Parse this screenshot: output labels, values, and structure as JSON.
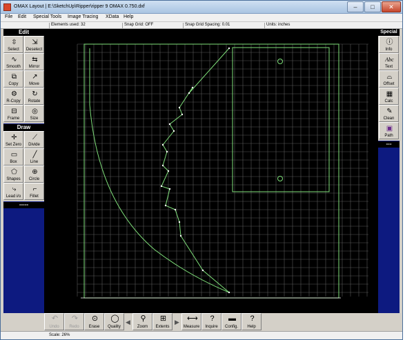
{
  "window": {
    "title": "OMAX Layout | E:\\SketchUp\\Ripper\\ripper 9 OMAX 0.750.dxf",
    "minimize": "–",
    "maximize": "□",
    "close": "✕"
  },
  "menu": [
    "File",
    "Edit",
    "Special Tools",
    "Image Tracing",
    "XData",
    "Help"
  ],
  "status": {
    "elements_used": "Elements used: 32",
    "snap_grid": "Snap Grid: OFF",
    "snap_spacing": "Snap Grid Spacing: 0.01",
    "units": "Units: inches"
  },
  "edit_panel": {
    "header": "Edit",
    "tools": [
      {
        "label": "Select",
        "icon": "select-icon",
        "glyph": "⇳"
      },
      {
        "label": "Deselect",
        "icon": "deselect-icon",
        "glyph": "⇲"
      },
      {
        "label": "Smooth",
        "icon": "smooth-icon",
        "glyph": "∿"
      },
      {
        "label": "Mirror",
        "icon": "mirror-icon",
        "glyph": "⇆"
      },
      {
        "label": "Copy",
        "icon": "copy-icon",
        "glyph": "⧉"
      },
      {
        "label": "Move",
        "icon": "move-icon",
        "glyph": "↗"
      },
      {
        "label": "R-Copy",
        "icon": "rotate-copy-icon",
        "glyph": "⚙"
      },
      {
        "label": "Rotate",
        "icon": "rotate-icon",
        "glyph": "↻"
      },
      {
        "label": "Frame",
        "icon": "frame-icon",
        "glyph": "⊟"
      },
      {
        "label": "Size",
        "icon": "size-icon",
        "glyph": "◎"
      }
    ]
  },
  "draw_panel": {
    "header": "Draw",
    "tools": [
      {
        "label": "Set Zero",
        "icon": "set-zero-icon",
        "glyph": "✛"
      },
      {
        "label": "Divide",
        "icon": "divide-icon",
        "glyph": "⟋"
      },
      {
        "label": "Box",
        "icon": "box-icon",
        "glyph": "▭"
      },
      {
        "label": "Line",
        "icon": "line-icon",
        "glyph": "╱"
      },
      {
        "label": "Shapes",
        "icon": "shapes-icon",
        "glyph": "⬠"
      },
      {
        "label": "Circle",
        "icon": "circle-icon",
        "glyph": "⊕"
      },
      {
        "label": "Lead i/o",
        "icon": "lead-io-icon",
        "glyph": "⤷"
      },
      {
        "label": "Fillet",
        "icon": "fillet-icon",
        "glyph": "⌐"
      }
    ],
    "dashes": "-----"
  },
  "special_panel": {
    "header": "Special",
    "tools": [
      {
        "label": "Info",
        "icon": "info-icon",
        "glyph": "ⓘ"
      },
      {
        "label": "Text",
        "icon": "text-icon",
        "glyph": "Abc"
      },
      {
        "label": "Offset",
        "icon": "offset-icon",
        "glyph": "⌓"
      },
      {
        "label": "Calc",
        "icon": "calculator-icon",
        "glyph": "▦"
      },
      {
        "label": "Clean",
        "icon": "clean-icon",
        "glyph": "✎"
      },
      {
        "label": "Path",
        "icon": "path-icon",
        "glyph": "▣"
      }
    ],
    "dashes": "---"
  },
  "bottom_toolbar": [
    {
      "label": "Undo",
      "icon": "undo-icon",
      "glyph": "↶",
      "disabled": true
    },
    {
      "label": "Redo",
      "icon": "redo-icon",
      "glyph": "↷",
      "disabled": true
    },
    {
      "label": "Erase",
      "icon": "erase-icon",
      "glyph": "⊙",
      "disabled": false
    },
    {
      "label": "Quality",
      "icon": "quality-icon",
      "glyph": "◯",
      "disabled": false
    },
    {
      "label": "Zoom",
      "icon": "zoom-icon",
      "glyph": "⚲",
      "disabled": false
    },
    {
      "label": "Extents",
      "icon": "extents-icon",
      "glyph": "⊞",
      "disabled": false
    },
    {
      "label": "Measure",
      "icon": "measure-icon",
      "glyph": "⟷",
      "disabled": false
    },
    {
      "label": "Inquire",
      "icon": "inquire-icon",
      "glyph": "?",
      "disabled": false
    },
    {
      "label": "Config.",
      "icon": "config-icon",
      "glyph": "▬",
      "disabled": false
    },
    {
      "label": "Help",
      "icon": "help-icon",
      "glyph": "?",
      "disabled": false
    }
  ],
  "scale": "Scale: 26%",
  "colors": {
    "canvas_bg": "#000000",
    "grid": "#5a5a5a",
    "geometry": "#7fe07a",
    "panel_bg": "#0d1a80"
  }
}
